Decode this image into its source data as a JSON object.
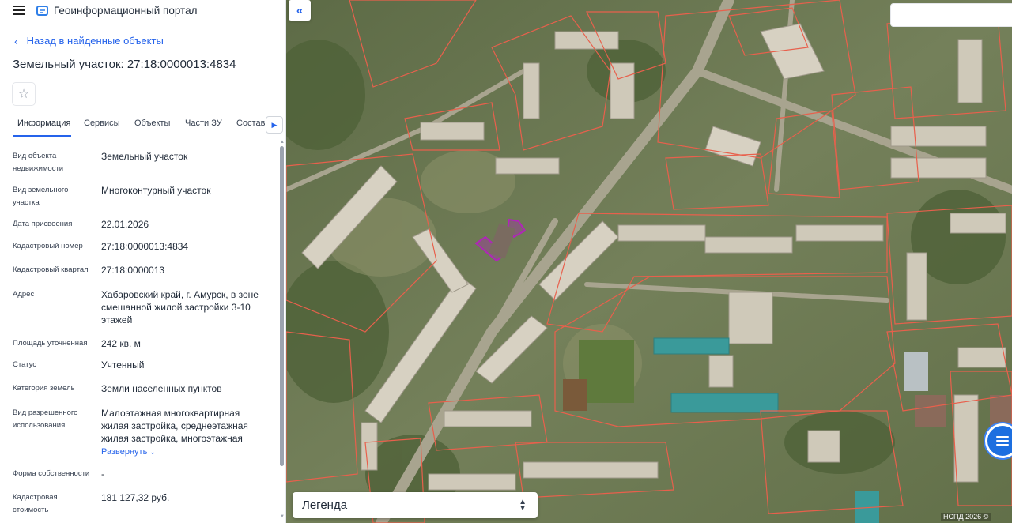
{
  "app": {
    "title": "Геоинформационный портал"
  },
  "nav": {
    "back_label": "Назад в найденные объекты"
  },
  "object": {
    "title": "Земельный участок: 27:18:0000013:4834"
  },
  "tabs": [
    {
      "label": "Информация",
      "active": true
    },
    {
      "label": "Сервисы"
    },
    {
      "label": "Объекты"
    },
    {
      "label": "Части ЗУ"
    },
    {
      "label": "Состав"
    }
  ],
  "fields": [
    {
      "label": "Вид объекта недвижимости",
      "value": "Земельный участок"
    },
    {
      "label": "Вид земельного участка",
      "value": "Многоконтурный участок"
    },
    {
      "label": "Дата присвоения",
      "value": "22.01.2026"
    },
    {
      "label": "Кадастровый номер",
      "value": "27:18:0000013:4834"
    },
    {
      "label": "Кадастровый квартал",
      "value": "27:18:0000013"
    },
    {
      "label": "Адрес",
      "value": "Хабаровский край, г. Амурск, в зоне смешанной жилой застройки 3-10 этажей"
    },
    {
      "label": "Площадь уточненная",
      "value": "242 кв. м"
    },
    {
      "label": "Статус",
      "value": "Учтенный"
    },
    {
      "label": "Категория земель",
      "value": "Земли населенных пунктов"
    },
    {
      "label": "Вид разрешенного использования",
      "value": "Малоэтажная многоквартирная жилая застройка, среднеэтажная жилая застройка, многоэтажная"
    },
    {
      "label": "Форма собственности",
      "value": "-"
    },
    {
      "label": "Кадастровая стоимость",
      "value": "181 127,32 руб."
    }
  ],
  "expand_label": "Развернуть",
  "map": {
    "legend_label": "Легенда",
    "copyright": "НСПД 2026 ©",
    "boundary_color": "#e8604c",
    "highlight_color": "#b026b8"
  }
}
